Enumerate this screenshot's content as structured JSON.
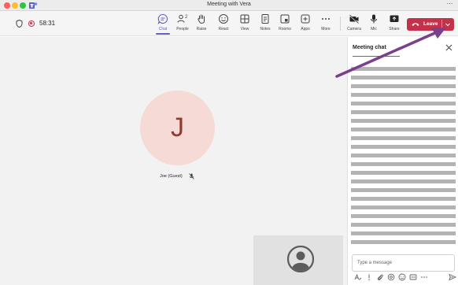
{
  "window": {
    "title": "Meeting with Vera",
    "more_glyph": "⋯",
    "logo_icon": "teams-logo-icon"
  },
  "toolbar": {
    "timer": "58:31",
    "buttons": [
      {
        "label": "Chat",
        "icon": "chat-icon",
        "active": true
      },
      {
        "label": "People",
        "icon": "people-icon",
        "badge": "2"
      },
      {
        "label": "Raise",
        "icon": "raise-hand-icon"
      },
      {
        "label": "React",
        "icon": "react-icon"
      },
      {
        "label": "View",
        "icon": "view-grid-icon"
      },
      {
        "label": "Notes",
        "icon": "notes-icon"
      },
      {
        "label": "Rooms",
        "icon": "rooms-icon"
      },
      {
        "label": "Apps",
        "icon": "apps-icon"
      },
      {
        "label": "More",
        "icon": "more-icon"
      },
      {
        "label": "Camera",
        "icon": "camera-off-icon"
      },
      {
        "label": "Mic",
        "icon": "mic-icon"
      },
      {
        "label": "Share",
        "icon": "share-icon"
      }
    ],
    "leave_label": "Leave",
    "leave_color": "#c4314b",
    "accent_color": "#5b5fc7"
  },
  "stage": {
    "participant_initial": "J",
    "participant_name": "Joe (Guest)",
    "avatar_bg": "#f5dad5",
    "avatar_fg": "#8e3b31"
  },
  "chat": {
    "title": "Meeting chat",
    "compose_placeholder": "Type a message"
  },
  "annotation": {
    "arrow_color": "#7b3f8c"
  }
}
